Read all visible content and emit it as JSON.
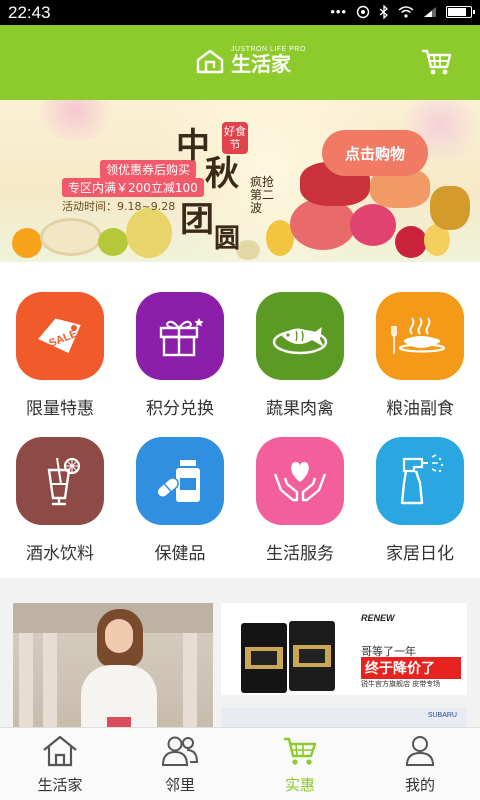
{
  "status_bar": {
    "time": "22:43"
  },
  "header": {
    "logo_sub": "JUSTRON LIFE PRO",
    "logo_text": "生活家",
    "cart_icon": "shopping-cart-icon"
  },
  "banner": {
    "tag1": "领优惠券后购买",
    "tag2": "专区内满￥200立减100",
    "date": "活动时间：9.18~9.28",
    "title_chars": [
      "中",
      "秋",
      "团",
      "圆"
    ],
    "badge": "好食节",
    "side_text": "疯抢第二波",
    "cta": "点击购物"
  },
  "categories": [
    {
      "label": "限量特惠",
      "icon": "sale-tag-icon",
      "color": "#f15a2a"
    },
    {
      "label": "积分兑换",
      "icon": "gift-icon",
      "color": "#8b1fa9"
    },
    {
      "label": "蔬果肉禽",
      "icon": "fish-plate-icon",
      "color": "#5c9a26"
    },
    {
      "label": "粮油副食",
      "icon": "noodle-bowl-icon",
      "color": "#f59a18"
    },
    {
      "label": "酒水饮料",
      "icon": "cocktail-icon",
      "color": "#8e4a44"
    },
    {
      "label": "保健品",
      "icon": "pill-bottle-icon",
      "color": "#2f8fe0"
    },
    {
      "label": "生活服务",
      "icon": "heart-hands-icon",
      "color": "#f25f9a"
    },
    {
      "label": "家居日化",
      "icon": "spray-bottle-icon",
      "color": "#2aa6e0"
    }
  ],
  "promo": {
    "belt_brand": "RENEW",
    "belt_title": "哥等了一年",
    "belt_big": "终于降价了",
    "belt_sub": "锐牛官方旗舰店  皮带专场",
    "bottom_brand": "SUBARU"
  },
  "tabs": [
    {
      "label": "生活家",
      "icon": "home-icon",
      "active": false
    },
    {
      "label": "邻里",
      "icon": "neighbors-icon",
      "active": false
    },
    {
      "label": "实惠",
      "icon": "cart-tab-icon",
      "active": true
    },
    {
      "label": "我的",
      "icon": "profile-icon",
      "active": false
    }
  ],
  "colors": {
    "brand_green": "#8ccb2b"
  }
}
